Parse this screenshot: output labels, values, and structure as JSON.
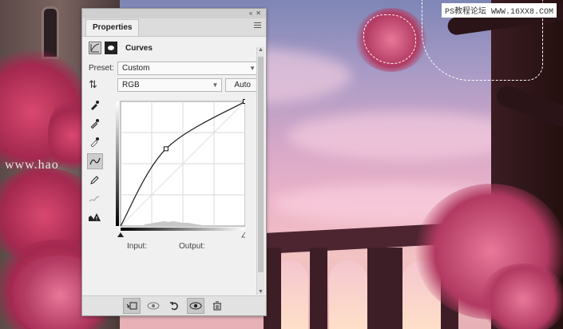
{
  "window": {
    "collapse_glyph": "«",
    "close_glyph": "✕"
  },
  "panel": {
    "tab_label": "Properties",
    "adjustment_title": "Curves",
    "preset_label": "Preset:",
    "preset_value": "Custom",
    "channel_value": "RGB",
    "auto_label": "Auto",
    "input_label": "Input:",
    "output_label": "Output:"
  },
  "tools": [
    {
      "name": "on-image-adjust-icon",
      "glyph": "☝"
    },
    {
      "name": "eyedropper-black-icon",
      "glyph": "✒"
    },
    {
      "name": "eyedropper-gray-icon",
      "glyph": "✒"
    },
    {
      "name": "eyedropper-white-icon",
      "glyph": "✒"
    },
    {
      "name": "curve-points-icon",
      "glyph": "∿"
    },
    {
      "name": "pencil-icon",
      "glyph": "✎"
    },
    {
      "name": "smooth-curve-icon",
      "glyph": "≈"
    },
    {
      "name": "clipping-warning-icon",
      "glyph": "⚠"
    }
  ],
  "bottom_bar": [
    {
      "name": "clip-to-layer-icon",
      "glyph": "⬚"
    },
    {
      "name": "view-previous-state-icon",
      "glyph": "◎"
    },
    {
      "name": "reset-icon",
      "glyph": "↺"
    },
    {
      "name": "visibility-eye-icon",
      "glyph": "👁"
    },
    {
      "name": "trash-icon",
      "glyph": "🗑"
    }
  ],
  "chart_data": {
    "type": "line",
    "title": "",
    "xlabel": "",
    "ylabel": "",
    "xlim": [
      0,
      255
    ],
    "ylim": [
      0,
      255
    ],
    "grid": true,
    "series": [
      {
        "points": [
          [
            0,
            0
          ],
          [
            93,
            158
          ],
          [
            255,
            255
          ]
        ]
      }
    ]
  },
  "colors": {
    "curve": "#1a1a1a",
    "grid": "#d9d9d9",
    "histogram": "#c8c8c8",
    "panel_bg": "#f0f0f0"
  },
  "watermark": {
    "top_right": "PS教程论坛 WWW.16XX8.COM",
    "left": "www.hao"
  }
}
